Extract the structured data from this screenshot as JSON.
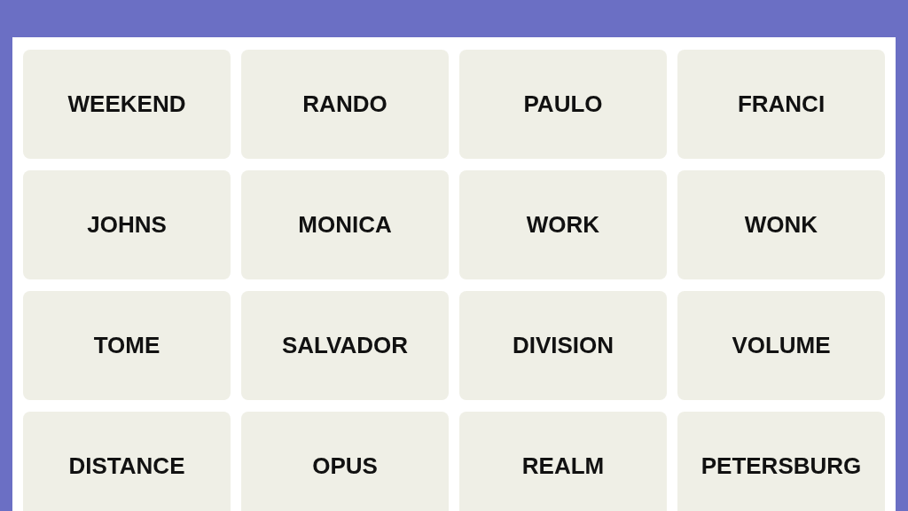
{
  "tiles": [
    {
      "word": "WEEKEND"
    },
    {
      "word": "RANDO"
    },
    {
      "word": "PAULO"
    },
    {
      "word": "FRANCI"
    },
    {
      "word": "JOHNS"
    },
    {
      "word": "MONICA"
    },
    {
      "word": "WORK"
    },
    {
      "word": "WONK"
    },
    {
      "word": "TOME"
    },
    {
      "word": "SALVADOR"
    },
    {
      "word": "DIVISION"
    },
    {
      "word": "VOLUME"
    },
    {
      "word": "DISTANCE"
    },
    {
      "word": "OPUS"
    },
    {
      "word": "REALM"
    },
    {
      "word": "PETERSBURG"
    }
  ]
}
